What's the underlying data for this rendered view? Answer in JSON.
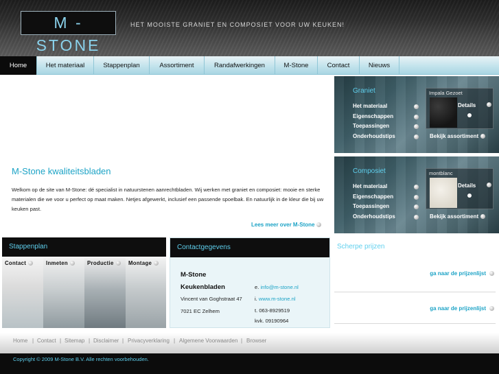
{
  "header": {
    "logo": "M - STONE",
    "tagline": "HET MOOISTE GRANIET EN COMPOSIET VOOR UW KEUKEN!"
  },
  "nav": [
    "Home",
    "Het materiaal",
    "Stappenplan",
    "Assortiment",
    "Randafwerkingen",
    "M-Stone",
    "Contact",
    "Nieuws"
  ],
  "intro": {
    "title": "M-Stone kwaliteitsbladen",
    "body": "Welkom op de site van M-Stone: dé specialist in natuurstenen aanrechtbladen. Wij werken met graniet en composiet: mooie en sterke materialen die we voor u perfect op maat maken. Netjes afgewerkt, inclusief een passende spoelbak. En natuurlijk in de kleur die bij uw keuken past.",
    "more_link": "Lees meer over M-Stone"
  },
  "graniet": {
    "title": "Graniet",
    "links": [
      "Het materiaal",
      "Eigenschappen",
      "Toepassingen",
      "Onderhoudstips"
    ],
    "sample_name": "Impala Gezoet",
    "details": "Details",
    "assortiment": "Bekijk assortiment"
  },
  "composiet": {
    "title": "Composiet",
    "links": [
      "Het materiaal",
      "Eigenschappen",
      "Toepassingen",
      "Onderhoudstips"
    ],
    "sample_name": "montblanc",
    "details": "Details",
    "assortiment": "Bekijk assortiment"
  },
  "stappenplan": {
    "title": "Stappenplan",
    "steps": [
      "Contact",
      "Inmeten",
      "Productie",
      "Montage"
    ]
  },
  "contact": {
    "title": "Contactgegevens",
    "name_line1": "M-Stone",
    "name_line2": "Keukenbladen",
    "street": "Vincent van Goghstraat 47",
    "city": "7021 EC Zelhem",
    "email_prefix": "e.",
    "email": "info@m-stone.nl",
    "web_prefix": "i.",
    "web": "www.m-stone.nl",
    "tel": "t. 063-8929519",
    "kvk": "kvk. 09190964"
  },
  "prices": {
    "title": "Scherpe prijzen",
    "link1": "ga naar de prijzenlijst",
    "link2": "ga naar de prijzenlijst"
  },
  "footer": {
    "links": [
      "Home",
      "Contact",
      "Sitemap",
      "Disclaimer",
      "Privacyverklaring",
      "Algemene Voorwaarden",
      "Browser"
    ],
    "copyright": "Copyright © 2009 M-Stone B.V. Alle rechten voorbehouden."
  },
  "colors": {
    "accent": "#1ca3c6",
    "accent_light": "#5fd0ee",
    "nav_active": "#0b0b0b"
  }
}
